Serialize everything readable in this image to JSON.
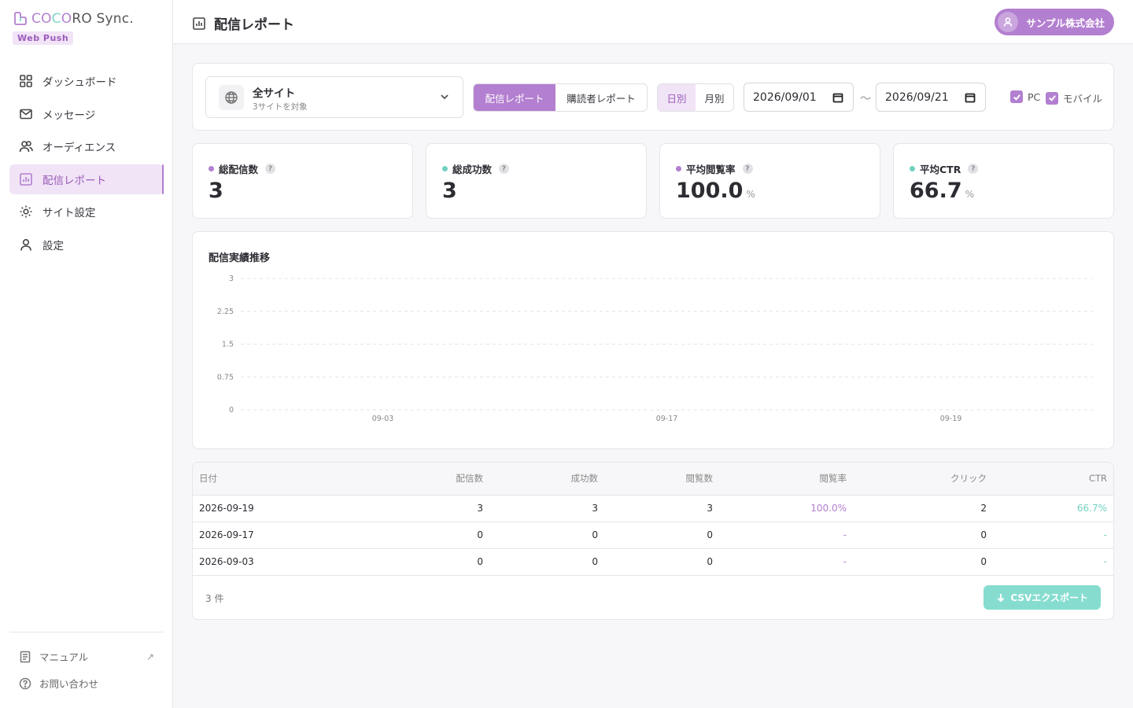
{
  "brand": {
    "name_prefix": "CO",
    "name_c": "C",
    "name_o": "O",
    "name_rest": "RO Sync.",
    "badge": "Web Push",
    "accent": "#b37fd0",
    "accent_light": "#f1e4f7",
    "teal": "#72d2c0"
  },
  "sidebar": {
    "items": [
      {
        "label": "ダッシュボード",
        "icon": "grid-icon"
      },
      {
        "label": "メッセージ",
        "icon": "mail-icon"
      },
      {
        "label": "オーディエンス",
        "icon": "users-icon"
      },
      {
        "label": "配信レポート",
        "icon": "report-icon",
        "active": true
      },
      {
        "label": "サイト設定",
        "icon": "gear-icon"
      },
      {
        "label": "設定",
        "icon": "user-icon"
      }
    ],
    "footer": {
      "manual": "マニュアル",
      "contact": "お問い合わせ"
    }
  },
  "header": {
    "title": "配信レポート",
    "user": "サンプル株式会社"
  },
  "filters": {
    "site_name": "全サイト",
    "site_sub": "3サイトを対象",
    "report_tabs": [
      "配信レポート",
      "購読者レポート"
    ],
    "period_tabs": [
      "日別",
      "月別"
    ],
    "date_from": "2026/09/01",
    "date_sep": "〜",
    "date_to": "2026/09/21",
    "device_pc": "PC",
    "device_mobile": "モバイル"
  },
  "stats": [
    {
      "label": "総配信数",
      "value": "3",
      "unit": "",
      "dot": "#b37fd0"
    },
    {
      "label": "総成功数",
      "value": "3",
      "unit": "",
      "dot": "#72d2c0"
    },
    {
      "label": "平均閲覧率",
      "value": "100.0",
      "unit": "%",
      "dot": "#b37fd0"
    },
    {
      "label": "平均CTR",
      "value": "66.7",
      "unit": "%",
      "dot": "#72d2c0"
    }
  ],
  "help_mark": "?",
  "chart": {
    "title": "配信実績推移"
  },
  "chart_data": {
    "type": "line",
    "title": "配信実績推移",
    "x": [
      "09-03",
      "09-17",
      "09-19"
    ],
    "yticks": [
      "3",
      "2.25",
      "1.5",
      "0.75",
      "0"
    ],
    "ylim": [
      0,
      3
    ],
    "grid": true
  },
  "table": {
    "headers": [
      "日付",
      "配信数",
      "成功数",
      "閲覧数",
      "閲覧率",
      "クリック",
      "CTR"
    ],
    "rows": [
      [
        "2026-09-19",
        "3",
        "3",
        "3",
        "100.0%",
        "2",
        "66.7%"
      ],
      [
        "2026-09-17",
        "0",
        "0",
        "0",
        "-",
        "0",
        "-"
      ],
      [
        "2026-09-03",
        "0",
        "0",
        "0",
        "-",
        "0",
        "-"
      ]
    ],
    "count": "3 件",
    "export": "CSVエクスポート"
  }
}
